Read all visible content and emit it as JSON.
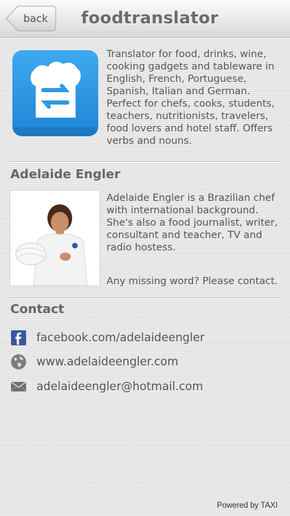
{
  "nav": {
    "back_label": "back",
    "title": "foodtranslator"
  },
  "app": {
    "icon_name": "translate-toque-icon",
    "description": "Translator for food, drinks, wine, cooking gadgets and tableware in English, French, Portuguese, Spanish, Italian and German. Perfect for chefs, cooks, students, teachers, nutritionists, travelers, food lovers and hotel staff. Offers verbs and nouns.",
    "accent": "#2e9ae6"
  },
  "author": {
    "name": "Adelaide Engler",
    "bio": "Adelaide Engler is a Brazilian chef with international background. She's also a food journalist, writer, consultant and teacher, TV and radio hostess.",
    "missing": "Any missing word? Please contact."
  },
  "contact": {
    "title": "Contact",
    "items": [
      {
        "icon": "facebook-icon",
        "text": "facebook.com/adelaideengler"
      },
      {
        "icon": "globe-icon",
        "text": "www.adelaideengler.com"
      },
      {
        "icon": "mail-icon",
        "text": "adelaideengler@hotmail.com"
      }
    ]
  },
  "footer": {
    "powered": "Powered by TAXI"
  }
}
